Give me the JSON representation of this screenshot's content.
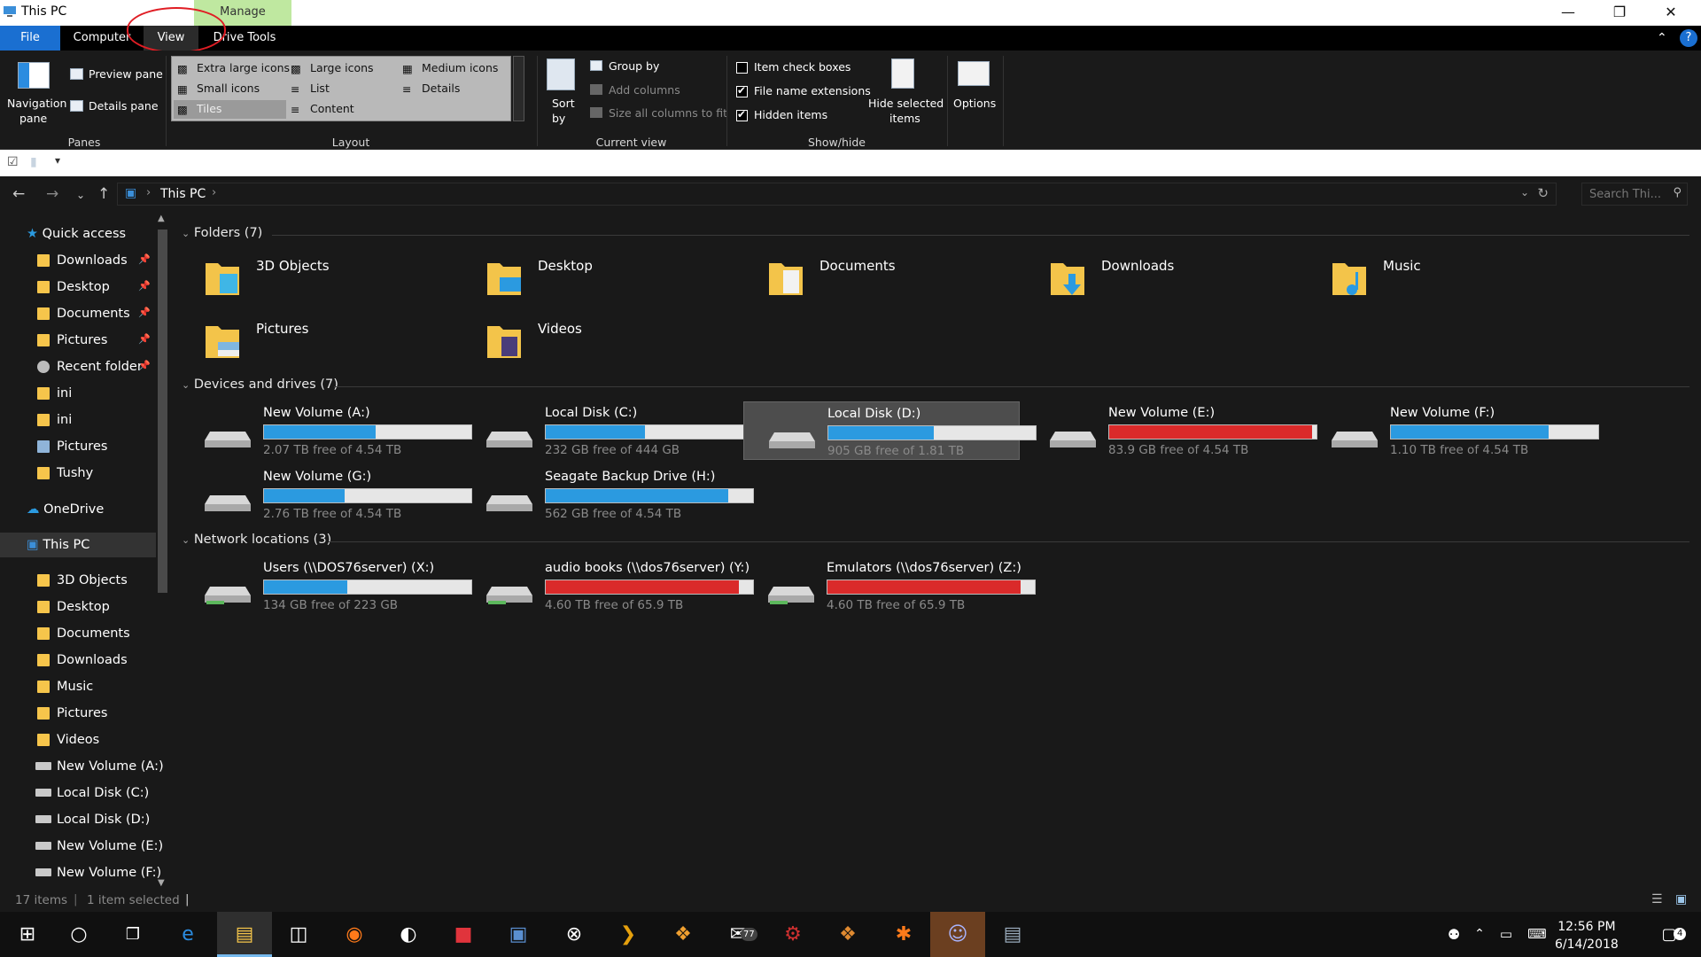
{
  "window": {
    "title": "This PC",
    "manage_label": "Manage"
  },
  "tabs": {
    "file": "File",
    "computer": "Computer",
    "view": "View",
    "drive_tools": "Drive Tools"
  },
  "ribbon": {
    "panes": {
      "navigation": "Navigation",
      "navigation2": "pane",
      "preview": "Preview pane",
      "details": "Details pane",
      "group": "Panes"
    },
    "layout": {
      "extra_large": "Extra large icons",
      "large": "Large icons",
      "medium": "Medium icons",
      "small": "Small icons",
      "list": "List",
      "details": "Details",
      "tiles": "Tiles",
      "content": "Content",
      "group": "Layout"
    },
    "current_view": {
      "sort": "Sort",
      "sort2": "by",
      "group_by": "Group by",
      "add_columns": "Add columns",
      "size_all": "Size all columns to fit",
      "group": "Current view"
    },
    "show_hide": {
      "item_check": "Item check boxes",
      "extensions": "File name extensions",
      "hidden": "Hidden items",
      "hide_selected": "Hide selected",
      "hide_selected2": "items",
      "group": "Show/hide"
    },
    "options": "Options"
  },
  "address": {
    "crumb": "This PC",
    "search_placeholder": "Search Thi..."
  },
  "sidebar": {
    "items": [
      {
        "label": "Quick access"
      },
      {
        "label": "Downloads"
      },
      {
        "label": "Desktop"
      },
      {
        "label": "Documents"
      },
      {
        "label": "Pictures"
      },
      {
        "label": "Recent folder"
      },
      {
        "label": "ini"
      },
      {
        "label": "ini"
      },
      {
        "label": "Pictures"
      },
      {
        "label": "Tushy"
      },
      {
        "label": "OneDrive"
      },
      {
        "label": "This PC"
      },
      {
        "label": "3D Objects"
      },
      {
        "label": "Desktop"
      },
      {
        "label": "Documents"
      },
      {
        "label": "Downloads"
      },
      {
        "label": "Music"
      },
      {
        "label": "Pictures"
      },
      {
        "label": "Videos"
      },
      {
        "label": "New Volume (A:)"
      },
      {
        "label": "Local Disk (C:)"
      },
      {
        "label": "Local Disk (D:)"
      },
      {
        "label": "New Volume (E:)"
      },
      {
        "label": "New Volume (F:)"
      }
    ]
  },
  "groups": {
    "folders": "Folders (7)",
    "drives": "Devices and drives (7)",
    "network": "Network locations (3)"
  },
  "folders": [
    "3D Objects",
    "Desktop",
    "Documents",
    "Downloads",
    "Music",
    "Pictures",
    "Videos"
  ],
  "drives": [
    {
      "name": "New Volume (A:)",
      "free": "2.07 TB free of 4.54 TB",
      "used": 0.54,
      "color": "#2b9ae0"
    },
    {
      "name": "Local Disk (C:)",
      "free": "232 GB free of 444 GB",
      "used": 0.48,
      "color": "#2b9ae0"
    },
    {
      "name": "Local Disk (D:)",
      "free": "905 GB free of 1.81 TB",
      "used": 0.51,
      "color": "#2b9ae0"
    },
    {
      "name": "New Volume (E:)",
      "free": "83.9 GB free of 4.54 TB",
      "used": 0.98,
      "color": "#da2a2a"
    },
    {
      "name": "New Volume (F:)",
      "free": "1.10 TB free of 4.54 TB",
      "used": 0.76,
      "color": "#2b9ae0"
    },
    {
      "name": "New Volume (G:)",
      "free": "2.76 TB free of 4.54 TB",
      "used": 0.39,
      "color": "#2b9ae0"
    },
    {
      "name": "Seagate Backup  Drive (H:)",
      "free": "562 GB free of 4.54 TB",
      "used": 0.88,
      "color": "#2b9ae0"
    }
  ],
  "network": [
    {
      "name": "Users (\\\\DOS76server) (X:)",
      "free": "134 GB free of 223 GB",
      "used": 0.4,
      "color": "#2b9ae0"
    },
    {
      "name": "audio books (\\\\dos76server) (Y:)",
      "free": "4.60 TB free of 65.9 TB",
      "used": 0.93,
      "color": "#da2a2a"
    },
    {
      "name": "Emulators (\\\\dos76server) (Z:)",
      "free": "4.60 TB free of 65.9 TB",
      "used": 0.93,
      "color": "#da2a2a"
    }
  ],
  "status": {
    "items": "17 items",
    "selected": "1 item selected"
  },
  "clock": {
    "time": "12:56 PM",
    "date": "6/14/2018"
  },
  "taskbar": {
    "mail_badge": "77",
    "notif_count": "4"
  }
}
